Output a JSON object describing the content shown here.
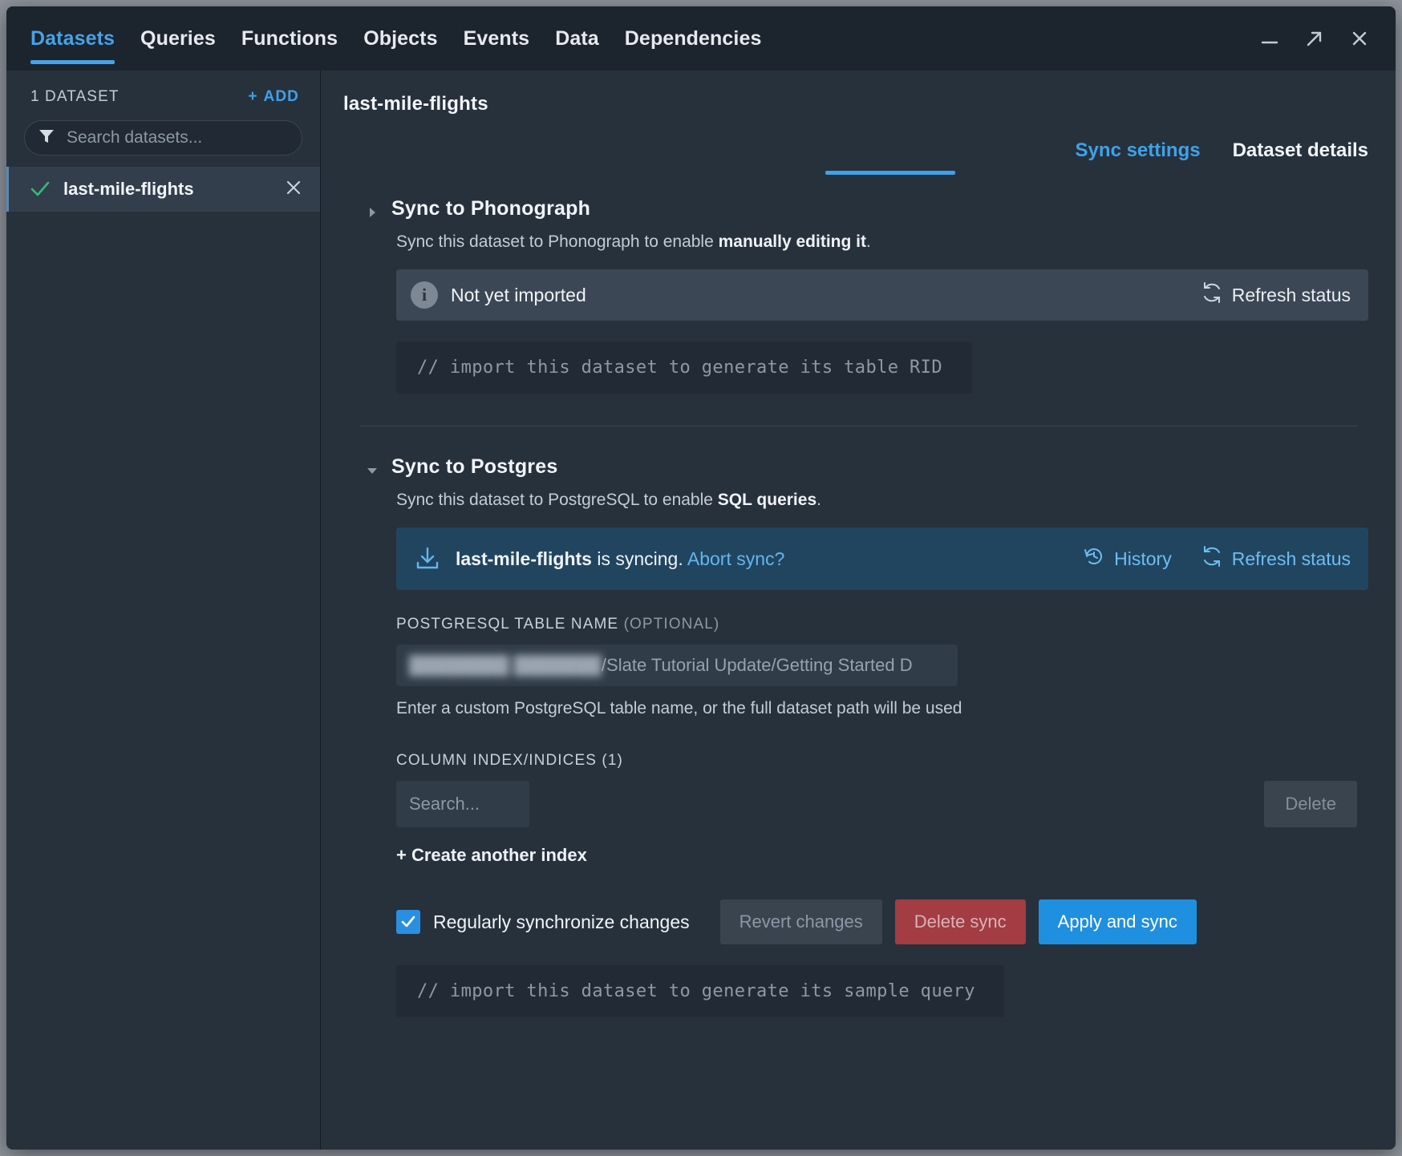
{
  "topnav": {
    "items": [
      {
        "label": "Datasets",
        "active": true
      },
      {
        "label": "Queries",
        "active": false
      },
      {
        "label": "Functions",
        "active": false
      },
      {
        "label": "Objects",
        "active": false
      },
      {
        "label": "Events",
        "active": false
      },
      {
        "label": "Data",
        "active": false
      },
      {
        "label": "Dependencies",
        "active": false
      }
    ]
  },
  "window_controls": {
    "minimize": "minimize-icon",
    "expand": "expand-icon",
    "close": "close-icon"
  },
  "sidebar": {
    "count_label": "1 DATASET",
    "add_label": "ADD",
    "add_plus": "+",
    "search_placeholder": "Search datasets...",
    "search_value": "",
    "datasets": [
      {
        "name": "last-mile-flights",
        "selected": true,
        "checked": true
      }
    ]
  },
  "main": {
    "title": "last-mile-flights",
    "tabs": [
      {
        "label": "Sync settings",
        "active": true
      },
      {
        "label": "Dataset details",
        "active": false
      }
    ],
    "phonograph": {
      "title": "Sync to Phonograph",
      "desc_prefix": "Sync this dataset to Phonograph to enable ",
      "desc_bold": "manually editing it",
      "desc_suffix": ".",
      "status": "Not yet imported",
      "refresh_label": "Refresh status",
      "code": "// import this dataset to generate its table RID",
      "expanded": false
    },
    "postgres": {
      "title": "Sync to Postgres",
      "desc_prefix": "Sync this dataset to PostgreSQL to enable ",
      "desc_bold": "SQL queries",
      "desc_suffix": ".",
      "expanded": true,
      "banner": {
        "dataset": "last-mile-flights",
        "state": " is syncing. ",
        "abort_label": "Abort sync?",
        "history_label": "History",
        "refresh_label": "Refresh status"
      },
      "table_name": {
        "label": "POSTGRESQL TABLE NAME",
        "optional": "(OPTIONAL)",
        "value_redacted": "████████ ███████",
        "value_visible": "/Slate Tutorial Update/Getting Started D",
        "helper": "Enter a custom PostgreSQL table name, or the full dataset path will be used"
      },
      "column_index": {
        "label": "COLUMN INDEX/INDICES (1)",
        "search_placeholder": "Search...",
        "delete_label": "Delete",
        "create_label": "+ Create another index"
      },
      "controls": {
        "sync_checkbox_label": "Regularly synchronize changes",
        "sync_checkbox_checked": true,
        "revert_label": "Revert changes",
        "delete_sync_label": "Delete sync",
        "apply_label": "Apply and sync"
      },
      "code": "// import this dataset to generate its sample query"
    }
  },
  "colors": {
    "accent_blue": "#3ea2ea",
    "primary_button": "#1f8fe0",
    "danger": "#a33c43",
    "check_green": "#39b87a",
    "banner_blue": "#21455f",
    "window_bg": "#27313c",
    "topbar_bg": "#1c242e"
  }
}
